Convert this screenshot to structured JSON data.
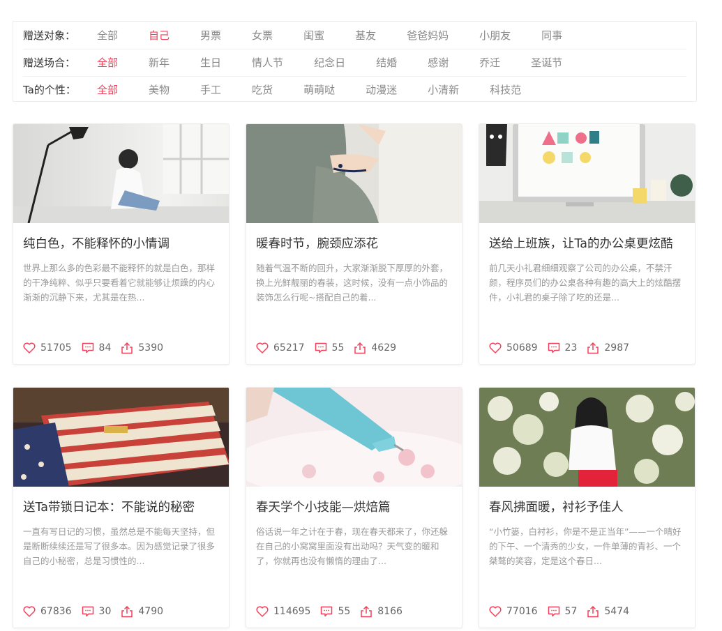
{
  "filters": [
    {
      "label": "赠送对象：",
      "options": [
        "全部",
        "自己",
        "男票",
        "女票",
        "闺蜜",
        "基友",
        "爸爸妈妈",
        "小朋友",
        "同事"
      ],
      "active": 1
    },
    {
      "label": "赠送场合：",
      "options": [
        "全部",
        "新年",
        "生日",
        "情人节",
        "纪念日",
        "结婚",
        "感谢",
        "乔迁",
        "圣诞节"
      ],
      "active": 0
    },
    {
      "label": "Ta的个性：",
      "options": [
        "全部",
        "美物",
        "手工",
        "吃货",
        "萌萌哒",
        "动漫迷",
        "小清新",
        "科技范"
      ],
      "active": 0
    }
  ],
  "accent_color": "#f0405a",
  "cards": [
    {
      "title": "纯白色，不能释怀的小情调",
      "desc": "世界上那么多的色彩最不能释怀的就是白色，那样的干净纯粹、似乎只要看着它就能够让烦躁的内心渐渐的沉静下来，尤其是在热...",
      "likes": "51705",
      "comments": "84",
      "shares": "5390"
    },
    {
      "title": "暖春时节，腕颈应添花",
      "desc": "随着气温不断的回升，大家渐渐脱下厚厚的外套，换上光鲜靓丽的春装，这时候，没有一点小饰品的装饰怎么行呢~搭配自己的着...",
      "likes": "65217",
      "comments": "55",
      "shares": "4629"
    },
    {
      "title": "送给上班族，让Ta的办公桌更炫酷",
      "desc": "前几天小礼君细细观察了公司的办公桌，不禁汗颜，程序员们的办公桌各种有趣的高大上的炫酷摆件，小礼君的桌子除了吃的还是...",
      "likes": "50689",
      "comments": "23",
      "shares": "2987"
    },
    {
      "title": "送Ta带锁日记本：不能说的秘密",
      "desc": "一直有写日记的习惯，虽然总是不能每天坚持，但是断断续续还是写了很多本。因为感觉记录了很多自己的小秘密，总是习惯性的...",
      "likes": "67836",
      "comments": "30",
      "shares": "4790"
    },
    {
      "title": "春天学个小技能—烘焙篇",
      "desc": "俗话说一年之计在于春，现在春天都来了，你还躲在自己的小窝窝里面没有出动吗？天气变的暖和了，你就再也没有懒惰的理由了...",
      "likes": "114695",
      "comments": "55",
      "shares": "8166"
    },
    {
      "title": "春风拂面暖，衬衫予佳人",
      "desc": "“小竹篓，白衬衫，你是不是正当年”——一个晴好的下午、一个清秀的少女，一件单薄的青衫、一个桀骜的笑容，定是这个春日...",
      "likes": "77016",
      "comments": "57",
      "shares": "5474"
    }
  ]
}
